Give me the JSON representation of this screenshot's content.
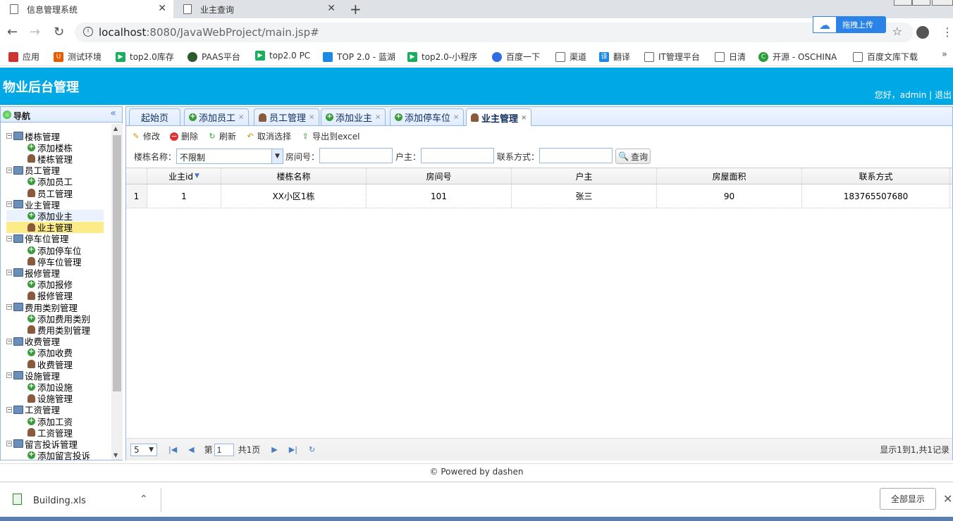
{
  "browser": {
    "tabs": [
      {
        "title": "信息管理系统",
        "active": true
      },
      {
        "title": "业主查询",
        "active": false
      }
    ],
    "url_host": "localhost",
    "url_path": ":8080/JavaWebProject/main.jsp#",
    "upload_label": "拖拽上传",
    "bookmarks": [
      "应用",
      "测试环境",
      "top2.0库存",
      "PAAS平台",
      "top2.0 PC",
      "TOP 2.0 - 蓝湖",
      "top2.0-小程序",
      "百度一下",
      "渠道",
      "翻译",
      "IT管理平台",
      "日清",
      "开源 - OSCHINA",
      "百度文库下载"
    ]
  },
  "app": {
    "title": "物业后台管理",
    "greeting": "您好，admin | 退出"
  },
  "nav": {
    "title": "导航",
    "groups": [
      {
        "label": "楼栋管理",
        "children": [
          "添加楼栋",
          "楼栋管理"
        ]
      },
      {
        "label": "员工管理",
        "children": [
          "添加员工",
          "员工管理"
        ]
      },
      {
        "label": "业主管理",
        "children": [
          "添加业主",
          "业主管理"
        ]
      },
      {
        "label": "停车位管理",
        "children": [
          "添加停车位",
          "停车位管理"
        ]
      },
      {
        "label": "报修管理",
        "children": [
          "添加报修",
          "报修管理"
        ]
      },
      {
        "label": "费用类别管理",
        "children": [
          "添加费用类别",
          "费用类别管理"
        ]
      },
      {
        "label": "收费管理",
        "children": [
          "添加收费",
          "收费管理"
        ]
      },
      {
        "label": "设施管理",
        "children": [
          "添加设施",
          "设施管理"
        ]
      },
      {
        "label": "工资管理",
        "children": [
          "添加工资",
          "工资管理"
        ]
      },
      {
        "label": "留言投诉管理",
        "children": [
          "添加留言投诉"
        ]
      }
    ]
  },
  "tabs": [
    "起始页",
    "添加员工",
    "员工管理",
    "添加业主",
    "添加停车位",
    "业主管理"
  ],
  "toolbar": {
    "edit": "修改",
    "delete": "删除",
    "refresh": "刷新",
    "cancel": "取消选择",
    "export": "导出到excel"
  },
  "search": {
    "building_label": "楼栋名称：",
    "building_value": "不限制",
    "room_label": "房间号：",
    "owner_label": "户主：",
    "phone_label": "联系方式：",
    "query": "查询"
  },
  "grid": {
    "columns": [
      "业主id",
      "楼栋名称",
      "房间号",
      "户主",
      "房屋面积",
      "联系方式"
    ],
    "rows": [
      {
        "num": "1",
        "cells": [
          "1",
          "XX小区1栋",
          "101",
          "张三",
          "90",
          "183765507680"
        ]
      }
    ]
  },
  "pager": {
    "page_size": "5",
    "page_prefix": "第",
    "page_value": "1",
    "page_suffix": "共1页",
    "info": "显示1到1,共1记录"
  },
  "footer": "© Powered by dashen",
  "download": {
    "file": "Building.xls",
    "show_all": "全部显示"
  }
}
